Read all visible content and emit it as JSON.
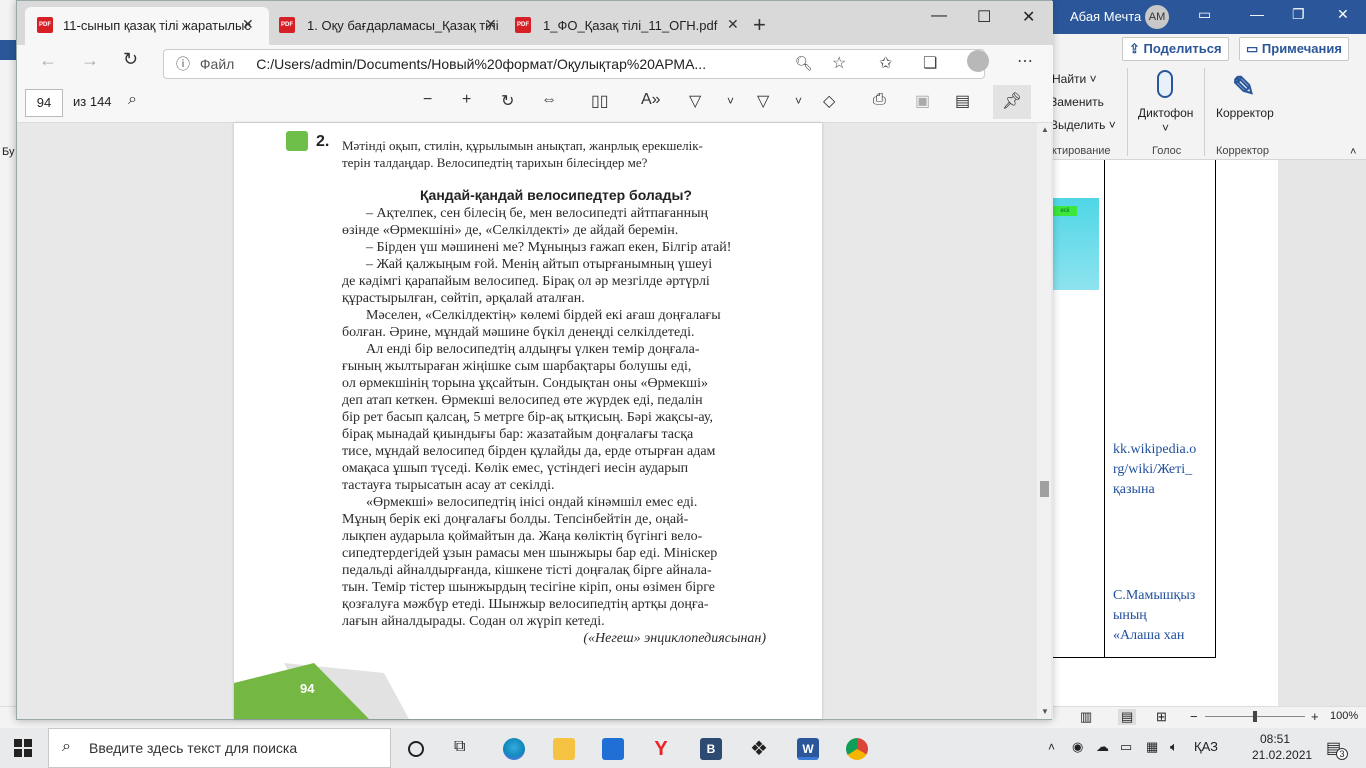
{
  "word": {
    "user_name": "Абая Мечта",
    "user_initials": "АМ",
    "share_label": "Поделиться",
    "notes_label": "Примечания",
    "find_label": "Найти",
    "replace_label": "Заменить",
    "select_label": "Выделить",
    "dictate_label": "Диктофон",
    "corrector_label": "Корректор",
    "group_edit": "ктирование",
    "group_voice": "Голос",
    "group_corrector": "Корректор",
    "image_tag": "ecii",
    "link1": [
      "kk.wikipedia.o",
      "rg/wiki/Жеті_",
      "қазына"
    ],
    "link2": [
      "С.Мамышқыз",
      "ының",
      "«Алаша хан"
    ],
    "zoom": "100%",
    "left_strip_text": "Бу"
  },
  "edge": {
    "tabs": [
      {
        "label": "11-сынып қазақ тілі жаратылыс"
      },
      {
        "label": "1. Оқу бағдарламасы_Қазақ тілі"
      },
      {
        "label": "1_ФО_Қазақ тілі_11_ОГН.pdf"
      }
    ],
    "pdf_icon_text": "PDF",
    "address_prefix": "Файл",
    "address_url": "C:/Users/admin/Documents/Новый%20формат/Оқулықтар%20АРМА...",
    "page_current": "94",
    "page_total": "из 144"
  },
  "pdf": {
    "task_number": "2.",
    "task_text": [
      "Мәтінді оқып, стилін, құрылымын анықтап, жанрлық ерекшелік-",
      "терін талдаңдар. Велосипедтің тарихын білесіңдер ме?"
    ],
    "heading": "Қандай-қандай велосипедтер болады?",
    "lines": [
      "– Ақтелпек, сен білесің бе, мен велосипедті айтпағанның",
      "өзінде «Өрмекшіні» де, «Селкілдекті» де айдай беремін.",
      "– Бірден үш мәшинені ме? Мұныңыз ғажап екен, Білгір атай!",
      "– Жай қалжыңым ғой. Менің айтып отырғанымның үшеуі",
      "де кәдімгі қарапайым велосипед. Бірақ ол әр мезгілде әртүрлі",
      "құрастырылған, сөйтіп, әрқалай аталған.",
      "Мәселен, «Селкілдектің» көлемі бірдей екі ағаш доңғалағы",
      "болған. Әрине, мұндай мәшине бүкіл денеңді селкілдетеді.",
      "Ал енді бір велосипедтің алдыңғы үлкен темір доңғала-",
      "ғының жылтыраған жіңішке сым шарбақтары болушы еді,",
      "ол өрмекшінің торына ұқсайтын. Сондықтан оны «Өрмекші»",
      "деп атап кеткен. Өрмекші велосипед өте жүрдек еді, педалін",
      "бір рет басып қалсаң, 5 метрге бір-ақ ытқисың. Бәрі жақсы-ау,",
      "бірақ мынадай қиындығы бар: жазатайым доңғалағы тасқа",
      "тисе, мұндай велосипед бірден құлайды да, ерде отырған адам",
      "омақаса ұшып түседі. Көлік емес, үстіндегі иесін аударып",
      "тастауға тырысатын асау ат секілді.",
      "«Өрмекші» велосипедтің інісі ондай кінәмшіл емес еді.",
      "Мұның берік екі доңғалағы болды. Тепсінбейтін де, оңай-",
      "лықпен аударыла қоймайтын да. Жаңа көліктің бүгінгі вело-",
      "сипедтердегідей ұзын рамасы мен шынжыры бар еді. Мініскер",
      "педальді айналдырғанда, кішкене тісті доңғалақ бірге айнала-",
      "тын. Темір тістер шынжырдың тесігіне кіріп, оны өзімен бірге",
      "қозғалуға мәжбүр етеді. Шынжыр велосипедтің артқы доңға-",
      "лағын айналдырады. Содан ол жүріп кетеді."
    ],
    "source": "(«Негеш» энциклопедиясынан)",
    "page_number": "94"
  },
  "taskbar": {
    "search_placeholder": "Введите здесь текст для поиска",
    "language": "ҚАЗ",
    "time": "08:51",
    "date": "21.02.2021",
    "notifications": "3"
  }
}
